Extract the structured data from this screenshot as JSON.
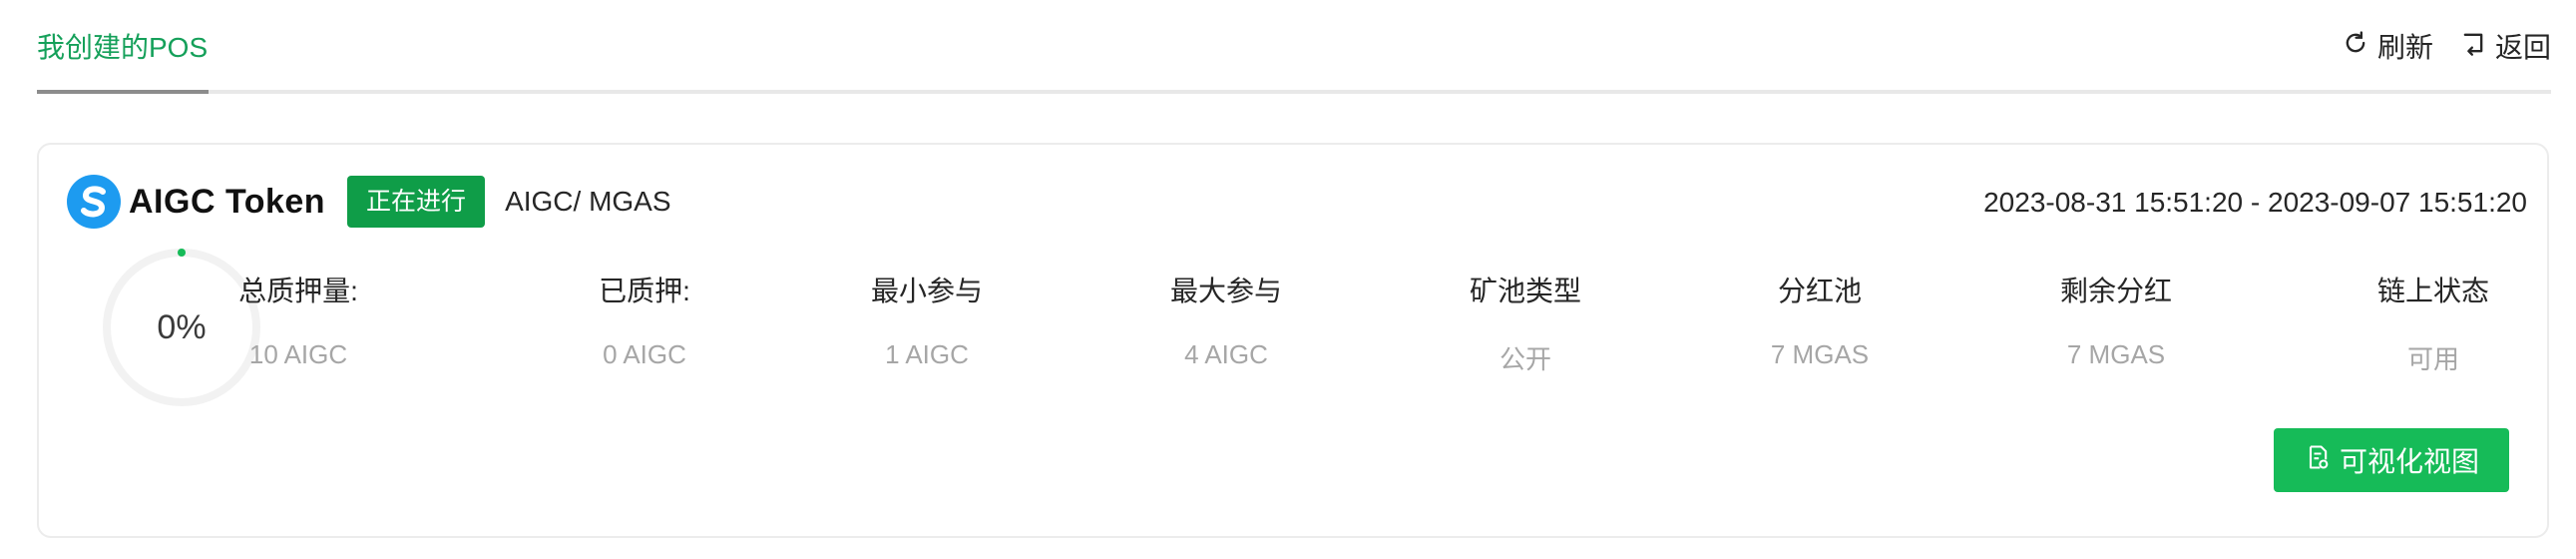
{
  "header": {
    "active_tab": "我创建的POS",
    "refresh_label": "刷新",
    "back_label": "返回"
  },
  "pos_card": {
    "token_name": "AIGC Token",
    "status": "正在进行",
    "pair": "AIGC/ MGAS",
    "time_range": "2023-08-31 15:51:20 - 2023-09-07 15:51:20",
    "progress_label": "0%",
    "progress_fraction": 0,
    "stats": [
      {
        "label": "总质押量:",
        "value": "10 AIGC"
      },
      {
        "label": "已质押:",
        "value": "0 AIGC"
      },
      {
        "label": "最小参与",
        "value": "1 AIGC"
      },
      {
        "label": "最大参与",
        "value": "4 AIGC"
      },
      {
        "label": "矿池类型",
        "value": "公开"
      },
      {
        "label": "分红池",
        "value": "7 MGAS"
      },
      {
        "label": "剩余分红",
        "value": "7 MGAS"
      },
      {
        "label": "链上状态",
        "value": "可用"
      }
    ],
    "visualize_label": "可视化视图"
  },
  "colors": {
    "tab_active": "#15a05a",
    "status_tag": "#0f9d48",
    "primary_button": "#16bb58",
    "token_logo": "#1d9bf0"
  },
  "icons": {
    "refresh": "refresh-icon",
    "back": "back-icon",
    "token": "token-logo-icon",
    "visualize": "document-icon"
  }
}
